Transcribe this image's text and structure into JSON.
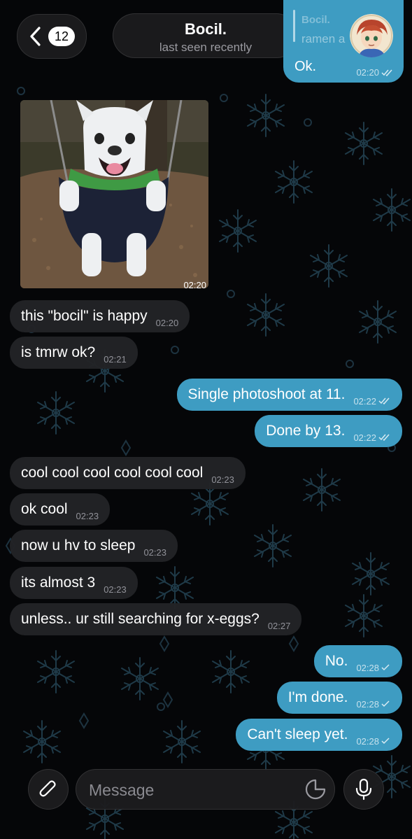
{
  "header": {
    "back_badge": "12",
    "chat_name": "Bocil.",
    "status": "last seen recently"
  },
  "quoted_message": {
    "reply_name": "Bocil.",
    "reply_text": "ramen a",
    "text": "Ok.",
    "time": "02:20"
  },
  "photo": {
    "time": "02:20"
  },
  "messages": [
    {
      "text": "this \"bocil\" is happy",
      "time": "02:20",
      "dir": "in"
    },
    {
      "text": "is tmrw ok?",
      "time": "02:21",
      "dir": "in"
    },
    {
      "text": "Single photoshoot at 11.",
      "time": "02:22",
      "dir": "out"
    },
    {
      "text": "Done by 13.",
      "time": "02:22",
      "dir": "out"
    },
    {
      "text": "cool cool cool cool cool cool",
      "time": "02:23",
      "dir": "in"
    },
    {
      "text": "ok cool",
      "time": "02:23",
      "dir": "in"
    },
    {
      "text": "now u hv to sleep",
      "time": "02:23",
      "dir": "in"
    },
    {
      "text": "its almost 3",
      "time": "02:23",
      "dir": "in"
    },
    {
      "text": "unless.. ur still searching for x-eggs?",
      "time": "02:27",
      "dir": "in"
    },
    {
      "text": "No.",
      "time": "02:28",
      "dir": "out"
    },
    {
      "text": "I'm done.",
      "time": "02:28",
      "dir": "out"
    },
    {
      "text": "Can't sleep yet.",
      "time": "02:28",
      "dir": "out"
    }
  ],
  "composer": {
    "placeholder": "Message"
  },
  "colors": {
    "outgoing": "#3e9cc2",
    "incoming": "#222326",
    "background": "#050608"
  },
  "icons": [
    "back-chevron-icon",
    "paperclip-icon",
    "sticker-icon",
    "microphone-icon",
    "double-check-icon",
    "single-check-icon"
  ]
}
